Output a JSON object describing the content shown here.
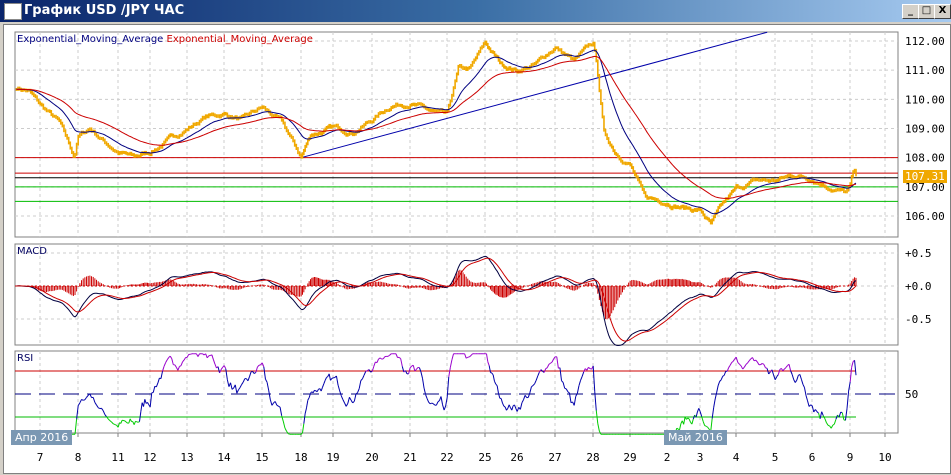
{
  "window": {
    "title": "График USD /JPY  ЧАС",
    "minimize": "_",
    "maximize": "□",
    "close": "X"
  },
  "legend": {
    "ema1": "Exponential_Moving_Average",
    "ema2": "Exponential_Moving_Average",
    "macd": "MACD",
    "rsi": "RSI"
  },
  "colors": {
    "price": "#f0a800",
    "ema_fast": "#000080",
    "ema_slow": "#cc0000",
    "trend": "#0000aa",
    "level_red": "#cc0000",
    "level_green": "#00bb00",
    "current": "#f0a800"
  },
  "current_price": "107.31",
  "month_badges": [
    "Апр 2016",
    "Май 2016"
  ],
  "chart_data": {
    "type": "line",
    "title": "USD/JPY hourly",
    "price_axis": {
      "ticks": [
        "112.00",
        "111.00",
        "110.00",
        "109.00",
        "108.00",
        "107.00",
        "106.00"
      ],
      "ylim": [
        105.7,
        112.3
      ]
    },
    "macd_axis": {
      "ticks": [
        "+0.5",
        "+0.0",
        "-0.5"
      ]
    },
    "rsi_axis": {
      "ticks": [
        "50"
      ],
      "upper": 70,
      "lower": 30
    },
    "x_ticks": [
      "7",
      "8",
      "11",
      "12",
      "13",
      "14",
      "15",
      "18",
      "19",
      "20",
      "21",
      "22",
      "25",
      "26",
      "27",
      "28",
      "29",
      "2",
      "3",
      "4",
      "5",
      "6",
      "9",
      "10"
    ],
    "levels": [
      {
        "price": 108.0,
        "color": "red"
      },
      {
        "price": 107.47,
        "color": "red"
      },
      {
        "price": 107.31,
        "color": "black"
      },
      {
        "price": 107.0,
        "color": "green"
      },
      {
        "price": 106.5,
        "color": "green"
      }
    ],
    "trendline": [
      [
        7,
        108.0
      ],
      [
        19.8,
        112.3
      ]
    ],
    "price_keypoints": [
      [
        -0.62,
        110.4
      ],
      [
        -0.3,
        110.3
      ],
      [
        0,
        109.8
      ],
      [
        0.5,
        109.2
      ],
      [
        0.9,
        108.0
      ],
      [
        1.0,
        108.7
      ],
      [
        1.3,
        109.0
      ],
      [
        1.7,
        108.5
      ],
      [
        2,
        108.2
      ],
      [
        2.5,
        108.0
      ],
      [
        3,
        108.2
      ],
      [
        3.5,
        108.6
      ],
      [
        4,
        109.0
      ],
      [
        4.5,
        109.4
      ],
      [
        5,
        109.5
      ],
      [
        5.5,
        109.3
      ],
      [
        6,
        109.7
      ],
      [
        6.5,
        109.2
      ],
      [
        7,
        108.0
      ],
      [
        7.3,
        108.8
      ],
      [
        8,
        109.0
      ],
      [
        8.5,
        108.9
      ],
      [
        9,
        109.3
      ],
      [
        9.5,
        109.8
      ],
      [
        10,
        109.9
      ],
      [
        10.5,
        109.6
      ],
      [
        11,
        109.4
      ],
      [
        11.3,
        111.0
      ],
      [
        11.6,
        111.0
      ],
      [
        12,
        111.9
      ],
      [
        12.5,
        111.2
      ],
      [
        13,
        111.0
      ],
      [
        13.5,
        111.2
      ],
      [
        14,
        111.8
      ],
      [
        14.5,
        111.3
      ],
      [
        15,
        111.9
      ],
      [
        15.1,
        111.2
      ],
      [
        15.3,
        108.8
      ],
      [
        15.6,
        108.2
      ],
      [
        16,
        107.8
      ],
      [
        16.4,
        106.6
      ],
      [
        17,
        106.5
      ],
      [
        17.5,
        106.3
      ],
      [
        18,
        106.2
      ],
      [
        18.3,
        105.7
      ],
      [
        18.6,
        106.3
      ],
      [
        19,
        106.9
      ],
      [
        19.5,
        107.2
      ],
      [
        20,
        107.2
      ],
      [
        20.5,
        107.4
      ],
      [
        21,
        107.3
      ],
      [
        21.5,
        107.0
      ],
      [
        21.9,
        106.8
      ],
      [
        22,
        107.0
      ],
      [
        22.1,
        107.5
      ],
      [
        22.2,
        107.3
      ]
    ]
  }
}
